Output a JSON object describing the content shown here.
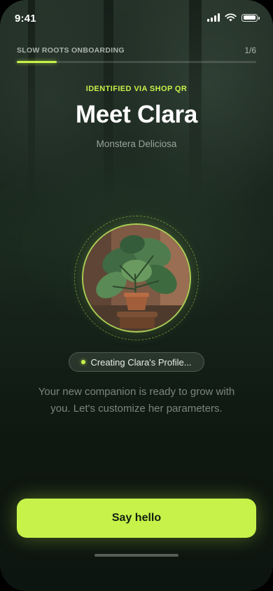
{
  "status_bar": {
    "time": "9:41"
  },
  "onboarding": {
    "label": "SLOW ROOTS ONBOARDING",
    "step_current": 1,
    "step_total": 6,
    "step_text": "1/6",
    "progress": 0.1667
  },
  "hero": {
    "eyebrow": "IDENTIFIED VIA SHOP QR",
    "title": "Meet Clara",
    "species": "Monstera Deliciosa"
  },
  "status_chip": {
    "text": "Creating Clara's Profile..."
  },
  "description": "Your new companion is ready to grow with you. Let's customize her parameters.",
  "cta": {
    "label": "Say hello"
  },
  "colors": {
    "accent": "#c6f24a",
    "background": "#15221a",
    "text_primary": "#ffffff"
  },
  "icons": [
    "signal-icon",
    "wifi-icon",
    "battery-icon",
    "plant-photo"
  ]
}
